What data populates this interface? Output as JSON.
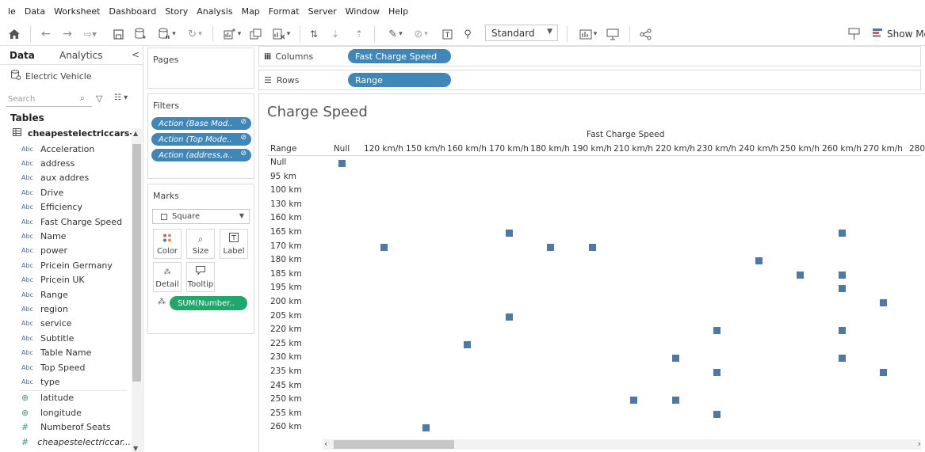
{
  "menu": [
    "le",
    "Data",
    "Worksheet",
    "Dashboard",
    "Story",
    "Analysis",
    "Map",
    "Format",
    "Server",
    "Window",
    "Help"
  ],
  "toolbar": {
    "fit_value": "Standard",
    "show_me_label": "Show Me",
    "icons": [
      "home-icon",
      "undo-icon",
      "redo-icon",
      "replay-icon",
      "save-icon",
      "new-datasource-icon",
      "pause-updates-icon",
      "refresh-icon",
      "new-worksheet-icon",
      "duplicate-sheet-icon",
      "clear-sheet-icon",
      "swap-icon",
      "sort-ascending-icon",
      "sort-descending-icon",
      "highlight-icon",
      "group-icon",
      "label-icon",
      "pin-icon",
      "show-cards-icon",
      "presentation-icon",
      "share-icon",
      "tooltip-icon",
      "show-me-icon"
    ]
  },
  "data_pane": {
    "tab_data": "Data",
    "tab_analytics": "Analytics",
    "collapse_glyph": "<",
    "datasource_name": "Electric Vehicle",
    "search_placeholder": "Search",
    "tables_heading": "Tables",
    "table_name": "cheapestelectriccars-...",
    "fields": [
      {
        "type": "Abc",
        "name": "Acceleration"
      },
      {
        "type": "Abc",
        "name": "address"
      },
      {
        "type": "Abc",
        "name": "aux addres"
      },
      {
        "type": "Abc",
        "name": "Drive"
      },
      {
        "type": "Abc",
        "name": "Efficiency"
      },
      {
        "type": "Abc",
        "name": "Fast Charge Speed"
      },
      {
        "type": "Abc",
        "name": "Name"
      },
      {
        "type": "Abc",
        "name": "power"
      },
      {
        "type": "Abc",
        "name": "Pricein Germany"
      },
      {
        "type": "Abc",
        "name": "Pricein UK"
      },
      {
        "type": "Abc",
        "name": "Range"
      },
      {
        "type": "Abc",
        "name": "region"
      },
      {
        "type": "Abc",
        "name": "service"
      },
      {
        "type": "Abc",
        "name": "Subtitle"
      },
      {
        "type": "Abc",
        "name": "Table Name"
      },
      {
        "type": "Abc",
        "name": "Top Speed"
      },
      {
        "type": "Abc",
        "name": "type"
      },
      {
        "type": "geo",
        "name": "latitude"
      },
      {
        "type": "geo",
        "name": "longitude"
      },
      {
        "type": "#",
        "name": "Numberof Seats"
      },
      {
        "type": "#",
        "name": "cheapestelectriccar..."
      }
    ]
  },
  "cards": {
    "pages_title": "Pages",
    "filters_title": "Filters",
    "filters": [
      "Action (Base Mod..",
      "Action (Top Mode..",
      "Action (address,a.."
    ],
    "marks_title": "Marks",
    "mark_type": "Square",
    "mark_buttons": [
      {
        "label": "Color",
        "icon": "color-icon"
      },
      {
        "label": "Size",
        "icon": "size-icon"
      },
      {
        "label": "Label",
        "icon": "label-icon"
      },
      {
        "label": "Detail",
        "icon": "detail-icon"
      },
      {
        "label": "Tooltip",
        "icon": "tooltip-icon"
      }
    ],
    "sum_pill": "SUM(Number.."
  },
  "shelves": {
    "columns_label": "Columns",
    "columns_pill": "Fast Charge Speed",
    "rows_label": "Rows",
    "rows_pill": "Range"
  },
  "view": {
    "sheet_title": "Charge Speed",
    "column_field": "Fast Charge Speed",
    "row_field": "Range",
    "mark_color": "#4e79a7",
    "pill_blue": "#3f87b8",
    "pill_green": "#1fa86a"
  },
  "chart_data": {
    "type": "heatmap",
    "title": "Charge Speed",
    "xlabel": "Fast Charge Speed",
    "ylabel": "Range",
    "x_categories": [
      "Null",
      "120 km/h",
      "150 km/h",
      "160 km/h",
      "170 km/h",
      "180 km/h",
      "190 km/h",
      "210 km/h",
      "220 km/h",
      "230 km/h",
      "240 km/h",
      "250 km/h",
      "260 km/h",
      "270 km/h",
      "280"
    ],
    "y_categories": [
      "Null",
      "95 km",
      "100 km",
      "130 km",
      "160 km",
      "165 km",
      "170 km",
      "180 km",
      "185 km",
      "195 km",
      "200 km",
      "205 km",
      "220 km",
      "225 km",
      "230 km",
      "235 km",
      "245 km",
      "250 km",
      "255 km",
      "260 km"
    ],
    "points": [
      {
        "x": "Null",
        "y": "Null"
      },
      {
        "x": "170 km/h",
        "y": "165 km"
      },
      {
        "x": "260 km/h",
        "y": "165 km"
      },
      {
        "x": "120 km/h",
        "y": "170 km"
      },
      {
        "x": "180 km/h",
        "y": "170 km"
      },
      {
        "x": "190 km/h",
        "y": "170 km"
      },
      {
        "x": "240 km/h",
        "y": "180 km"
      },
      {
        "x": "250 km/h",
        "y": "185 km"
      },
      {
        "x": "260 km/h",
        "y": "185 km"
      },
      {
        "x": "260 km/h",
        "y": "195 km"
      },
      {
        "x": "270 km/h",
        "y": "200 km"
      },
      {
        "x": "170 km/h",
        "y": "205 km"
      },
      {
        "x": "230 km/h",
        "y": "220 km"
      },
      {
        "x": "260 km/h",
        "y": "220 km"
      },
      {
        "x": "160 km/h",
        "y": "225 km"
      },
      {
        "x": "220 km/h",
        "y": "230 km"
      },
      {
        "x": "260 km/h",
        "y": "230 km"
      },
      {
        "x": "230 km/h",
        "y": "235 km"
      },
      {
        "x": "270 km/h",
        "y": "235 km"
      },
      {
        "x": "210 km/h",
        "y": "250 km"
      },
      {
        "x": "220 km/h",
        "y": "250 km"
      },
      {
        "x": "230 km/h",
        "y": "255 km"
      },
      {
        "x": "150 km/h",
        "y": "260 km"
      }
    ]
  }
}
